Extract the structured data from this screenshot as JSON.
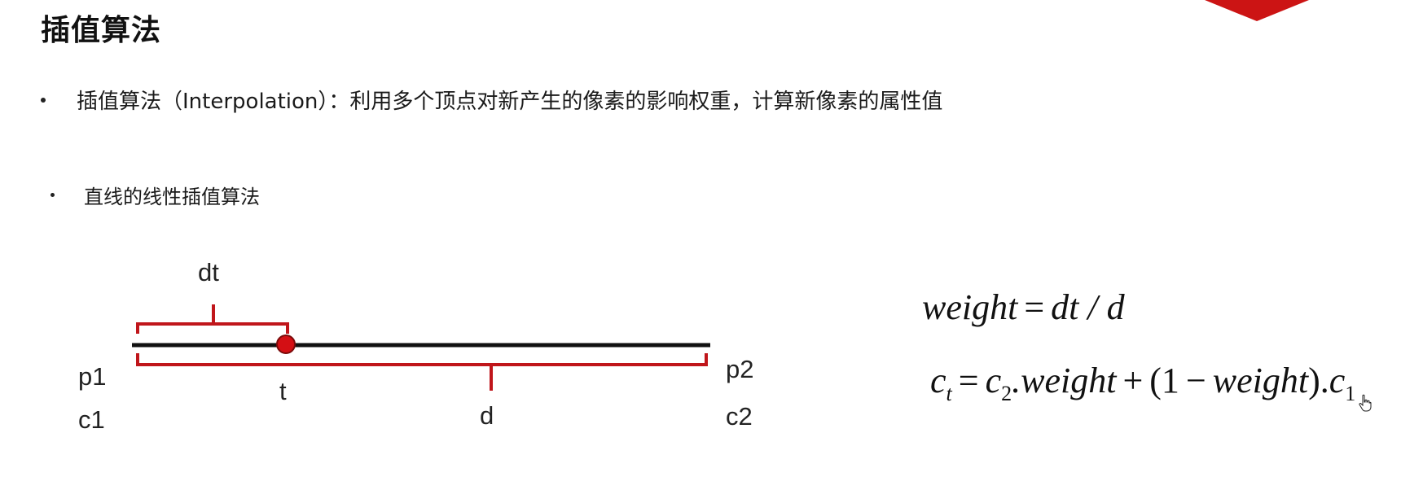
{
  "slide": {
    "title": "插值算法",
    "bullets": [
      "插值算法（Interpolation）：利用多个顶点对新产生的像素的影响权重，计算新像素的属性值",
      "直线的线性插值算法"
    ]
  },
  "diagram": {
    "labels": {
      "dt": "dt",
      "p1": "p1",
      "c1": "c1",
      "t": "t",
      "d": "d",
      "p2": "p2",
      "c2": "c2"
    },
    "colors": {
      "line": "#111111",
      "bracket": "#c0161b",
      "point": "#d40f14",
      "point_stroke": "#7a0a0a"
    }
  },
  "formulas": {
    "weight_lhs": "weight",
    "weight_eq": "=",
    "weight_rhs": "dt / d",
    "ct_c": "c",
    "ct_sub": "t",
    "ct_eq": "=",
    "c2_c": "c",
    "c2_sub": "2",
    "term1": ".weight",
    "plus": "+",
    "paren_open": "(1",
    "minus": "−",
    "term2": "weight",
    "paren_close": ").",
    "c1_c": "c",
    "c1_sub": "1"
  },
  "decor": {
    "corner_color": "#cc1414",
    "cursor_icon": "hand-pointer-icon"
  }
}
